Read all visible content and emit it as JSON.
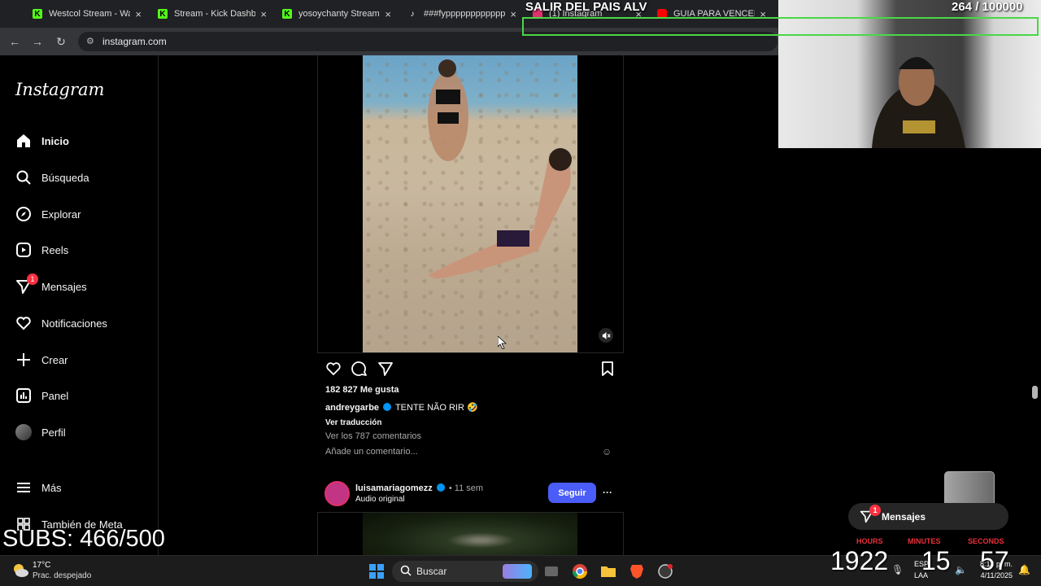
{
  "browser": {
    "tabs": [
      {
        "title": "Westcol Stream - Wat",
        "icon": "kick-icon"
      },
      {
        "title": "Stream - Kick Dashboa",
        "icon": "kick-icon"
      },
      {
        "title": "yosoychanty Stream -",
        "icon": "kick-icon"
      },
      {
        "title": "###fypppppppppppppp",
        "icon": "tiktok-icon"
      },
      {
        "title": "(1) Instagram",
        "icon": "instagram-icon"
      },
      {
        "title": "GUIA PARA VENCER A",
        "icon": "youtube-icon"
      }
    ],
    "url": "instagram.com"
  },
  "sidebar": {
    "logo": "Instagram",
    "items": [
      {
        "label": "Inicio",
        "icon": "home-icon"
      },
      {
        "label": "Búsqueda",
        "icon": "search-icon"
      },
      {
        "label": "Explorar",
        "icon": "compass-icon"
      },
      {
        "label": "Reels",
        "icon": "reels-icon"
      },
      {
        "label": "Mensajes",
        "icon": "messenger-icon",
        "badge": "1"
      },
      {
        "label": "Notificaciones",
        "icon": "heart-icon"
      },
      {
        "label": "Crear",
        "icon": "plus-icon"
      },
      {
        "label": "Panel",
        "icon": "dashboard-icon"
      },
      {
        "label": "Perfil",
        "icon": "avatar"
      },
      {
        "label": "Más",
        "icon": "menu-icon"
      },
      {
        "label": "También de Meta",
        "icon": "meta-icon"
      }
    ]
  },
  "post": {
    "likes": "182 827 Me gusta",
    "username": "andreygarbe",
    "caption": "TENTE NÃO RIR",
    "emoji": "🤣",
    "translate": "Ver traducción",
    "view_comments": "Ver los 787 comentarios",
    "comment_placeholder": "Añade un comentario..."
  },
  "next_post": {
    "username": "luisamariagomezz",
    "time": "• 11 sem",
    "audio": "Audio original",
    "follow": "Seguir",
    "more": "···"
  },
  "overlay": {
    "title": "SALIR DEL PAIS ALV",
    "counter": "264  / 100000",
    "subs": "SUBS: 466/500",
    "messages": "Mensajes",
    "messages_badge": "1",
    "timer_labels": [
      "HOURS",
      "MINUTES",
      "SECONDS"
    ],
    "timer_values": [
      "1922",
      "15",
      "57"
    ]
  },
  "taskbar": {
    "weather_temp": "17°C",
    "weather_desc": "Prac. despejado",
    "search": "Buscar",
    "lang": "ESP",
    "lang2": "LAA",
    "time": "8:13 p. m.",
    "date": "4/11/2025"
  },
  "colors": {
    "accent": "#4a5df9",
    "badge": "#ff3040",
    "goal_border": "#49d845",
    "timer_label": "#e8303a"
  }
}
